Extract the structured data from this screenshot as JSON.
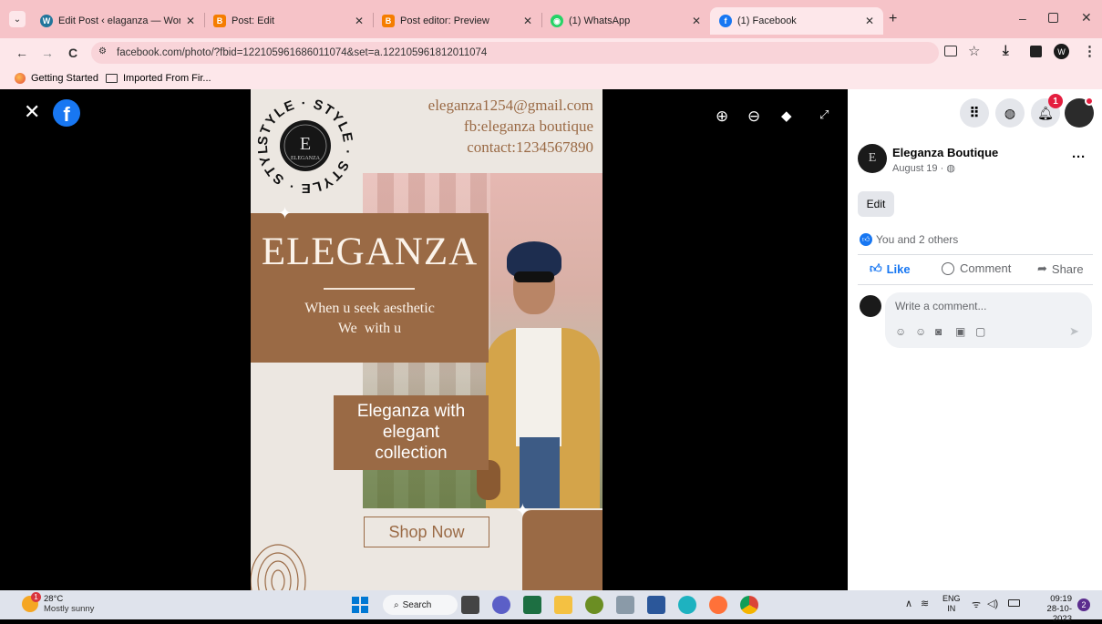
{
  "tabs": [
    {
      "title": "Edit Post ‹ elaganza — WordPr",
      "color": "#21759b",
      "icon": "wordpress-icon"
    },
    {
      "title": "Post: Edit",
      "color": "#f57d00",
      "icon": "blogger-icon"
    },
    {
      "title": "Post editor: Preview",
      "color": "#f57d00",
      "icon": "blogger-icon"
    },
    {
      "title": "(1) WhatsApp",
      "color": "#25d366",
      "icon": "whatsapp-icon"
    },
    {
      "title": "(1) Facebook",
      "color": "#1877f2",
      "icon": "facebook-icon"
    }
  ],
  "address": {
    "url": "facebook.com/photo/?fbid=122105961686011074&set=a.122105961812011074"
  },
  "bookmarks": [
    {
      "label": "Getting Started"
    },
    {
      "label": "Imported From Fir..."
    }
  ],
  "poster": {
    "email": "eleganza1254@gmail.com",
    "fb": "fb:eleganza boutique",
    "contact": "contact:1234567890",
    "brand": "ELEGANZA",
    "tagline1": "When u seek aesthetic",
    "tagline2": "We  with u",
    "promo1": "Eleganza with",
    "promo2": "elegant",
    "promo3": "collection",
    "cta": "Shop Now",
    "logo_word": "ELEGANZA",
    "ring_text": "STYLE · STYLE · STYLE · STYLE ·"
  },
  "panel": {
    "notification_count": "1",
    "page_name": "Eleganza Boutique",
    "date": "August 19 · ",
    "edit_label": "Edit",
    "reactions": "You and 2 others",
    "like_label": "Like",
    "comment_label": "Comment",
    "share_label": "Share",
    "comment_placeholder": "Write a comment...",
    "more": "···"
  },
  "taskbar": {
    "temp": "28°C",
    "weather": "Mostly sunny",
    "weather_badge": "1",
    "search": "Search",
    "lang1": "ENG",
    "lang2": "IN",
    "time": "09:19",
    "date": "28-10-2023",
    "notif": "2"
  },
  "colors": {
    "tabbar": "#f6c3c8",
    "toolbar": "#fde7ea",
    "brown": "#9a6a45",
    "facebook": "#1877f2"
  }
}
